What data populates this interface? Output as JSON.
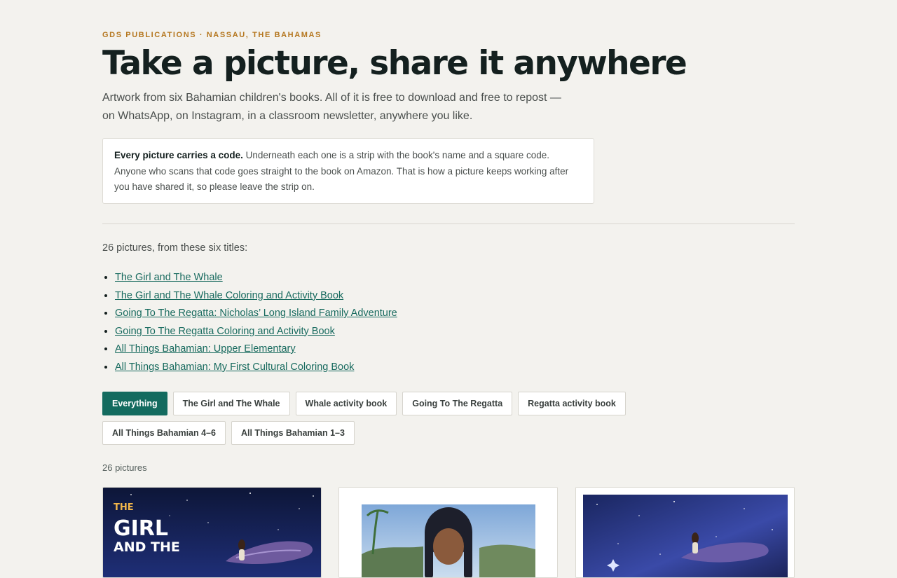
{
  "header": {
    "eyebrow": "GDS PUBLICATIONS · NASSAU, THE BAHAMAS",
    "title": "Take a picture, share it anywhere",
    "lede": "Artwork from six Bahamian children's books. All of it is free to download and free to repost — on WhatsApp, on Instagram, in a classroom newsletter, anywhere you like."
  },
  "note": {
    "lead": "Every picture carries a code.",
    "body": "Underneath each one is a strip with the book's name and a square code. Anyone who scans that code goes straight to the book on Amazon. That is how a picture keeps working after you have shared it, so please leave the strip on."
  },
  "titles_intro": "26 pictures, from these six titles:",
  "titles": [
    "The Girl and The Whale",
    "The Girl and The Whale Coloring and Activity Book",
    "Going To The Regatta: Nicholas’ Long Island Family Adventure",
    "Going To The Regatta Coloring and Activity Book",
    "All Things Bahamian: Upper Elementary",
    "All Things Bahamian: My First Cultural Coloring Book"
  ],
  "filters": [
    "Everything",
    "The Girl and The Whale",
    "Whale activity book",
    "Going To The Regatta",
    "Regatta activity book",
    "All Things Bahamian 4–6",
    "All Things Bahamian 1–3"
  ],
  "active_filter": "Everything",
  "picture_count": "26 pictures",
  "cover": {
    "line1": "THE",
    "line2": "GIRL",
    "line3": "AND THE"
  },
  "colors": {
    "accent": "#136b5f",
    "eyebrow": "#b5771f",
    "link": "#176a5e"
  }
}
